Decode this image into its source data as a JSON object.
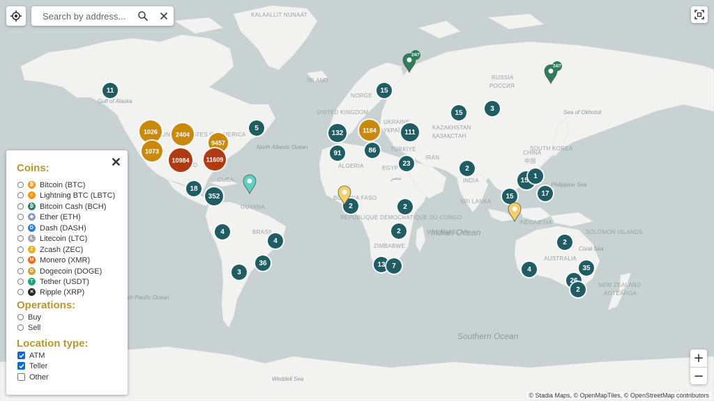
{
  "search": {
    "placeholder": "Search by address..."
  },
  "map_labels": {
    "oceans": [
      "North Atlantic Ocean",
      "Indian Ocean",
      "Southern Ocean",
      "South Pacific Ocean",
      "Gulf of Alaska",
      "Sea of Okhotsk",
      "Philippine Sea",
      "Coral Sea",
      "Weddell Sea"
    ],
    "countries": [
      "KALAALLIT NUNAAT",
      "ÍSLAND",
      "NORGE",
      "RUSSIA",
      "РОССИЯ",
      "UNITED KINGDOM",
      "UKRAINE",
      "УКРАЇНА",
      "KAZAKHSTAN",
      "ҚАЗАҚСТАН",
      "TÜRKİYE",
      "CHINA",
      "中国",
      "SOUTH KOREA",
      "ALGERIA",
      "EGYPT",
      "مصر",
      "IRAN",
      "INDIA",
      "SRI LANKA",
      "BURKINA FASO",
      "RÉPUBLIQUE DÉMOCRATIQUE DU CONGO",
      "ZIMBABWE",
      "MADAGASCAR",
      "INDONESIA",
      "SOLOMON ISLANDS",
      "AUSTRALIA",
      "NEW ZEALAND",
      "AOTEAROA",
      "MÉXICO",
      "CUBA",
      "BRASIL",
      "UNITED STATES OF AMERICA",
      "GUYANA"
    ]
  },
  "clusters": [
    {
      "label": "11",
      "style": "teal"
    },
    {
      "label": "1026",
      "style": "gold"
    },
    {
      "label": "2404",
      "style": "gold"
    },
    {
      "label": "9457",
      "style": "gold"
    },
    {
      "label": "1073",
      "style": "gold"
    },
    {
      "label": "10984",
      "style": "red"
    },
    {
      "label": "11609",
      "style": "red"
    },
    {
      "label": "5",
      "style": "teal"
    },
    {
      "label": "18",
      "style": "teal"
    },
    {
      "label": "352",
      "style": "teal"
    },
    {
      "label": "4",
      "style": "teal"
    },
    {
      "label": "4",
      "style": "teal"
    },
    {
      "label": "36",
      "style": "teal"
    },
    {
      "label": "3",
      "style": "teal"
    },
    {
      "label": "15",
      "style": "teal"
    },
    {
      "label": "132",
      "style": "teal"
    },
    {
      "label": "1184",
      "style": "gold"
    },
    {
      "label": "111",
      "style": "teal"
    },
    {
      "label": "91",
      "style": "teal"
    },
    {
      "label": "86",
      "style": "teal"
    },
    {
      "label": "23",
      "style": "teal"
    },
    {
      "label": "15",
      "style": "teal"
    },
    {
      "label": "3",
      "style": "teal"
    },
    {
      "label": "2",
      "style": "teal"
    },
    {
      "label": "2",
      "style": "teal"
    },
    {
      "label": "2",
      "style": "teal"
    },
    {
      "label": "2",
      "style": "teal"
    },
    {
      "label": "13",
      "style": "teal"
    },
    {
      "label": "7",
      "style": "teal"
    },
    {
      "label": "151",
      "style": "teal"
    },
    {
      "label": "1",
      "style": "teal"
    },
    {
      "label": "17",
      "style": "teal"
    },
    {
      "label": "15",
      "style": "teal"
    },
    {
      "label": "2",
      "style": "teal"
    },
    {
      "label": "4",
      "style": "teal"
    },
    {
      "label": "35",
      "style": "teal"
    },
    {
      "label": "26",
      "style": "teal"
    },
    {
      "label": "2",
      "style": "teal"
    }
  ],
  "pins": [
    {
      "label": "24/7",
      "color": "#2e7d5b"
    },
    {
      "label": "24/7",
      "color": "#2e7d5b"
    },
    {
      "label": "",
      "color": "#5ad1c6"
    },
    {
      "label": "",
      "color": "#f3cf6a"
    },
    {
      "label": "",
      "color": "#f3cf6a"
    }
  ],
  "filter": {
    "coins_title": "Coins:",
    "coins": [
      {
        "label": "Bitcoin (BTC)",
        "icon": "bitcoin-icon",
        "color": "#f7931a",
        "glyph": "₿"
      },
      {
        "label": "Lightning BTC (LBTC)",
        "icon": "lightning-icon",
        "color": "#f7931a",
        "glyph": "⚡"
      },
      {
        "label": "Bitcoin Cash (BCH)",
        "icon": "bitcoin-cash-icon",
        "color": "#2e7d5b",
        "glyph": "₿"
      },
      {
        "label": "Ether (ETH)",
        "icon": "ether-icon",
        "color": "#8a9bb5",
        "glyph": "◆"
      },
      {
        "label": "Dash (DASH)",
        "icon": "dash-icon",
        "color": "#2b7ed8",
        "glyph": "D"
      },
      {
        "label": "Litecoin (LTC)",
        "icon": "litecoin-icon",
        "color": "#a5a9b0",
        "glyph": "Ł"
      },
      {
        "label": "Zcash (ZEC)",
        "icon": "zcash-icon",
        "color": "#e4b123",
        "glyph": "Z"
      },
      {
        "label": "Monero (XMR)",
        "icon": "monero-icon",
        "color": "#f26822",
        "glyph": "M"
      },
      {
        "label": "Dogecoin (DOGE)",
        "icon": "dogecoin-icon",
        "color": "#c9a633",
        "glyph": "D"
      },
      {
        "label": "Tether (USDT)",
        "icon": "tether-icon",
        "color": "#26a17b",
        "glyph": "T"
      },
      {
        "label": "Ripple (XRP)",
        "icon": "ripple-icon",
        "color": "#23292f",
        "glyph": "✕"
      }
    ],
    "operations_title": "Operations:",
    "operations": [
      {
        "label": "Buy"
      },
      {
        "label": "Sell"
      }
    ],
    "location_title": "Location type:",
    "locations": [
      {
        "label": "ATM",
        "checked": true
      },
      {
        "label": "Teller",
        "checked": true
      },
      {
        "label": "Other",
        "checked": false
      }
    ]
  },
  "zoom": {
    "in": "+",
    "out": "−"
  },
  "attribution": "© Stadia Maps, © OpenMapTiles, © OpenStreetMap contributors",
  "colors": {
    "teal": "#1f5c63",
    "gold": "#c98a0c",
    "red": "#b03a12",
    "land": "#f2f2f0",
    "water": "#c9d2d3",
    "accent": "#b8962e"
  }
}
